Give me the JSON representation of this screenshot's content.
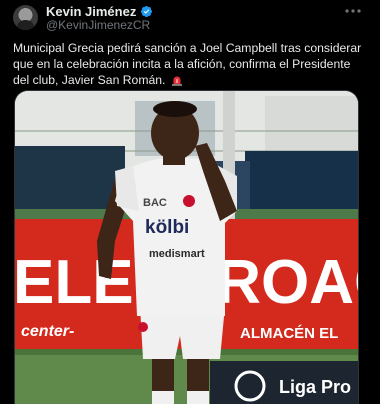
{
  "author": {
    "display_name": "Kevin Jiménez",
    "handle": "@KevinJimenezCR",
    "verified": true,
    "avatar_icon": "avatar-photo"
  },
  "more_icon": "more-horizontal-icon",
  "tweet": {
    "text": "Municipal Grecia pedirá sanción a Joel Campbell tras considerar que en la celebración incita a la afición, confirma el Presidente del club, Javier San Román.",
    "trailing_emoji": "rotating-light-icon"
  },
  "media": {
    "banner_text": "ELECTROAGEN",
    "banner_subtext_left": "center-",
    "banner_subtext_right": "ALMACÉN EL",
    "jersey_sponsor_main": "kölbi",
    "jersey_sponsor_top": "BAC",
    "jersey_sponsor_bottom": "medismart",
    "league_logo_text": "Liga Pro",
    "colors": {
      "banner_red": "#d42a1e",
      "jersey_white": "#f2f2f2",
      "grass": "#5f8a4c",
      "sky": "#cfd6d8"
    }
  }
}
